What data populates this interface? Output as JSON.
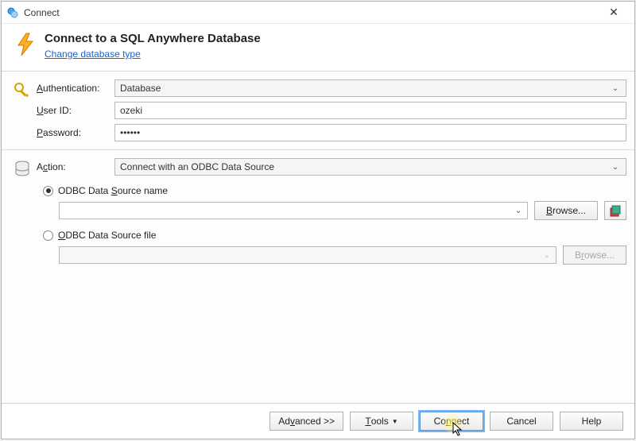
{
  "window": {
    "title": "Connect"
  },
  "header": {
    "title": "Connect to a SQL Anywhere Database",
    "link": "Change database type"
  },
  "auth": {
    "label_authentication": "Authentication:",
    "auth_value": "Database",
    "label_userid": "User ID:",
    "userid_value": "ozeki",
    "label_password": "Password:",
    "password_value": "••••••"
  },
  "action": {
    "label_action": "Action:",
    "action_value": "Connect with an ODBC Data Source",
    "radio_name_label": "ODBC Data Source name",
    "radio_file_label": "ODBC Data Source file",
    "odbc_name_value": "",
    "odbc_file_value": "",
    "browse_label": "Browse..."
  },
  "footer": {
    "advanced": "Advanced >>",
    "tools": "Tools",
    "connect": "Connect",
    "cancel": "Cancel",
    "help": "Help"
  }
}
